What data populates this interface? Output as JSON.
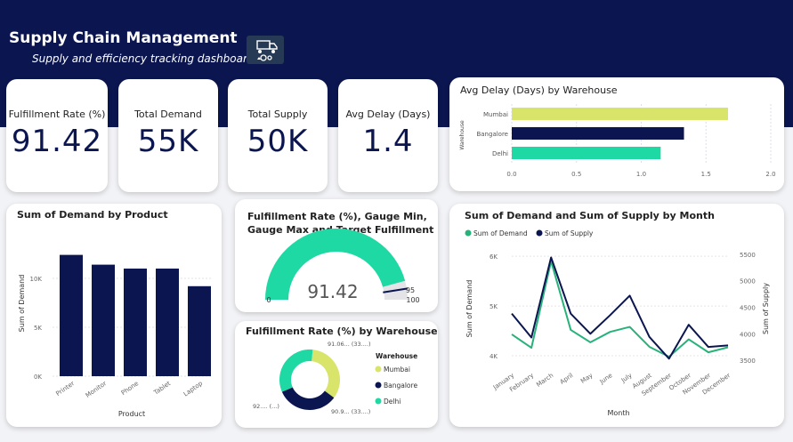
{
  "header": {
    "title": "Supply Chain Management",
    "subtitle": "Supply and efficiency tracking dashboard",
    "logo_icon": "supply-chain-icon"
  },
  "kpis": [
    {
      "label": "Fulfillment Rate (%)",
      "value": "91.42"
    },
    {
      "label": "Total Demand",
      "value": "55K"
    },
    {
      "label": "Total Supply",
      "value": "50K"
    },
    {
      "label": "Avg Delay (Days)",
      "value": "1.4"
    }
  ],
  "colors": {
    "navy": "#0b1650",
    "green": "#1ed9a4",
    "lime": "#d9e46a",
    "series_demand": "#27b27a"
  },
  "chart_data": [
    {
      "type": "bar",
      "orientation": "horizontal",
      "title": "Avg Delay (Days) by Warehouse",
      "ylabel": "Warehouse",
      "categories": [
        "Mumbai",
        "Bangalore",
        "Delhi"
      ],
      "values": [
        1.67,
        1.33,
        1.15
      ],
      "bar_colors": [
        "#d9e46a",
        "#0b1650",
        "#1ed9a4"
      ],
      "xlim": [
        0,
        2.0
      ],
      "xticks": [
        "0.0",
        "0.5",
        "1.0",
        "1.5",
        "2.0"
      ]
    },
    {
      "type": "bar",
      "title": "Sum of Demand by Product",
      "xlabel": "Product",
      "ylabel": "Sum of Demand",
      "categories": [
        "Printer",
        "Monitor",
        "Phone",
        "Tablet",
        "Laptop"
      ],
      "values": [
        12400,
        11400,
        11000,
        11000,
        9200
      ],
      "ylim": [
        0,
        14000
      ],
      "yticks": [
        {
          "v": 0,
          "label": "0K"
        },
        {
          "v": 5000,
          "label": "5K"
        },
        {
          "v": 10000,
          "label": "10K"
        }
      ]
    },
    {
      "type": "gauge",
      "title": "Fulfillment Rate (%), Gauge Min, Gauge Max and Target Fulfillment",
      "value": 91.42,
      "value_label": "91.42",
      "min": 0,
      "max": 100,
      "target": 95,
      "min_label": "0",
      "max_label": "100",
      "target_label": "95"
    },
    {
      "type": "pie",
      "title": "Fulfillment Rate (%) by Warehouse",
      "legend_title": "Warehouse",
      "legend_position": "right",
      "slices": [
        {
          "name": "Mumbai",
          "value": 92.0,
          "label": "92.... (...)",
          "color": "#d9e46a"
        },
        {
          "name": "Bangalore",
          "value": 91.06,
          "label": "91.06... (33....)",
          "color": "#0b1650"
        },
        {
          "name": "Delhi",
          "value": 90.9,
          "label": "90.9... (33....)",
          "color": "#1ed9a4"
        }
      ]
    },
    {
      "type": "line",
      "title": "Sum of Demand and Sum of Supply by Month",
      "xlabel": "Month",
      "ylabel": "Sum of Demand",
      "y2label": "Sum of Supply",
      "legend_position": "top-left",
      "categories": [
        "January",
        "February",
        "March",
        "April",
        "May",
        "June",
        "July",
        "August",
        "September",
        "October",
        "November",
        "December"
      ],
      "series": [
        {
          "name": "Sum of Demand",
          "axis": "left",
          "color": "#27b27a",
          "values": [
            4430,
            4160,
            5900,
            4520,
            4270,
            4480,
            4580,
            4180,
            3980,
            4330,
            4070,
            4170
          ]
        },
        {
          "name": "Sum of Supply",
          "axis": "right",
          "color": "#0b1650",
          "values": [
            4380,
            3930,
            5440,
            4380,
            4000,
            4350,
            4720,
            3940,
            3530,
            4170,
            3750,
            3780
          ]
        }
      ],
      "ylim": [
        3750,
        6200
      ],
      "y2lim": [
        3350,
        5650
      ],
      "yticks": [
        {
          "v": 4000,
          "label": "4K"
        },
        {
          "v": 5000,
          "label": "5K"
        },
        {
          "v": 6000,
          "label": "6K"
        }
      ],
      "y2ticks": [
        3500,
        4000,
        4500,
        5000,
        5500
      ]
    }
  ]
}
